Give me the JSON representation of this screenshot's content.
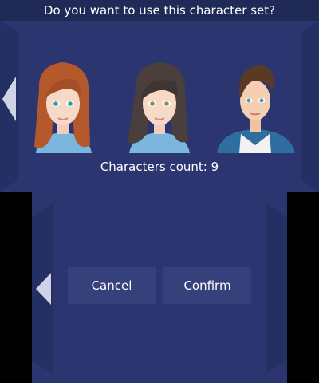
{
  "dialog": {
    "question": "Do you want to use this character set?",
    "count_label": "Characters count:",
    "count_value": "9"
  },
  "characters": [
    {
      "name": "character-1-portrait",
      "hair": "#b5582c",
      "eyes": "#2aa1a3",
      "shirt": "#7ab6dd"
    },
    {
      "name": "character-2-portrait",
      "hair": "#4a3f3c",
      "eyes": "#7c9b3b",
      "shirt": "#7ab6dd"
    },
    {
      "name": "character-3-portrait",
      "hair": "#5a3a24",
      "eyes": "#3aa3b3",
      "shirt": "#2f6e9e"
    }
  ],
  "buttons": {
    "cancel_label": "Cancel",
    "confirm_label": "Confirm"
  },
  "icons": {
    "top_left_arrow": "chevron-left-icon",
    "bottom_left_arrow": "chevron-left-icon"
  },
  "colors": {
    "background": "#2b3570",
    "title_bar": "#1f2a57",
    "button": "#36417b",
    "arrow": "#d0d3e6"
  }
}
